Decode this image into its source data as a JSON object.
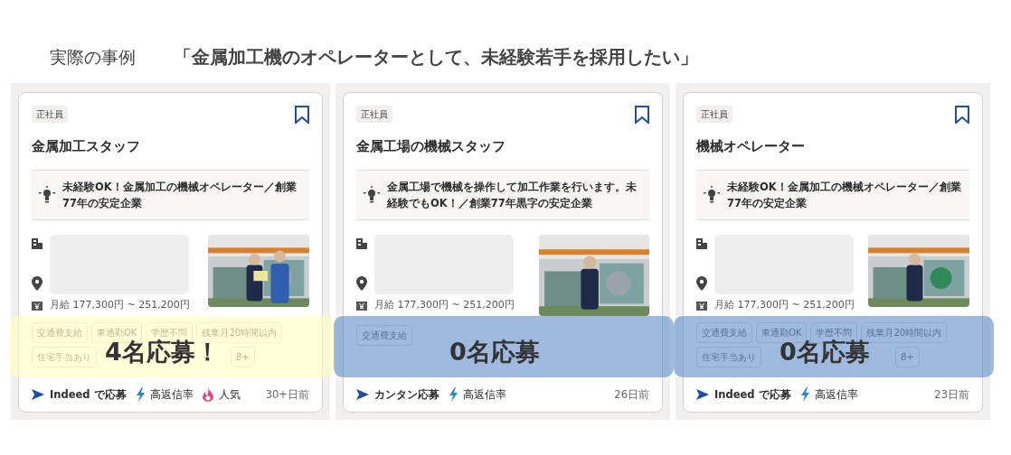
{
  "header": {
    "label": "実際の事例",
    "headline": "「金属加工機のオペレーターとして、未経験若手を採用したい」"
  },
  "cards": [
    {
      "employment_type": "正社員",
      "title": "金属加工スタッフ",
      "snippet": "未経験OK！金属加工の機械オペレーター／創業77年の安定企業",
      "salary": "月給 177,300円 ~ 251,200円",
      "photo": {
        "kind": "picture"
      },
      "tags": [
        {
          "kind": "label",
          "text": "交通費支給"
        },
        {
          "kind": "label",
          "text": "車通勤OK"
        },
        {
          "kind": "label",
          "text": "学歴不問"
        },
        {
          "kind": "label",
          "text": "残業月20時間以内"
        },
        {
          "kind": "label",
          "text": "住宅手当あり"
        },
        {
          "kind": "covered"
        },
        {
          "kind": "covered"
        },
        {
          "kind": "label",
          "text": "8+"
        }
      ],
      "apply_method": "Indeed で応募",
      "badges": [
        {
          "kind": "reply",
          "label": "高返信率"
        },
        {
          "kind": "popular",
          "label": "人気"
        }
      ],
      "posted": "30+日前",
      "callout": {
        "kind": "highlight",
        "text": "4名応募！"
      }
    },
    {
      "employment_type": "正社員",
      "title": "金属工場の機械スタッフ",
      "snippet": "金属工場で機械を操作して加工作業を行います。未経験でもOK！／創業77年黒字の安定企業",
      "salary": "月給 177,300円 ~ 251,200円",
      "photo": {
        "kind": "picture"
      },
      "tags": [
        {
          "kind": "label",
          "text": "交通費支給"
        }
      ],
      "apply_method": "カンタン応募",
      "badges": [
        {
          "kind": "reply",
          "label": "高返信率"
        }
      ],
      "posted": "26日前",
      "callout": {
        "kind": "muted",
        "text": "0名応募"
      }
    },
    {
      "employment_type": "正社員",
      "title": "機械オペレーター",
      "snippet": "未経験OK！金属加工の機械オペレーター／創業77年の安定企業",
      "salary": "月給 177,300円 ~ 251,200円",
      "photo": {
        "kind": "picture"
      },
      "tags": [
        {
          "kind": "label",
          "text": "交通費支給"
        },
        {
          "kind": "label",
          "text": "車通勤OK"
        },
        {
          "kind": "label",
          "text": "学歴不問"
        },
        {
          "kind": "label",
          "text": "残業月20時間以内"
        },
        {
          "kind": "label",
          "text": "住宅手当あり"
        },
        {
          "kind": "covered"
        },
        {
          "kind": "covered"
        },
        {
          "kind": "label",
          "text": "8+"
        }
      ],
      "apply_method": "Indeed で応募",
      "badges": [
        {
          "kind": "reply",
          "label": "高返信率"
        }
      ],
      "posted": "23日前",
      "callout": {
        "kind": "muted",
        "text": "0名応募"
      }
    }
  ]
}
